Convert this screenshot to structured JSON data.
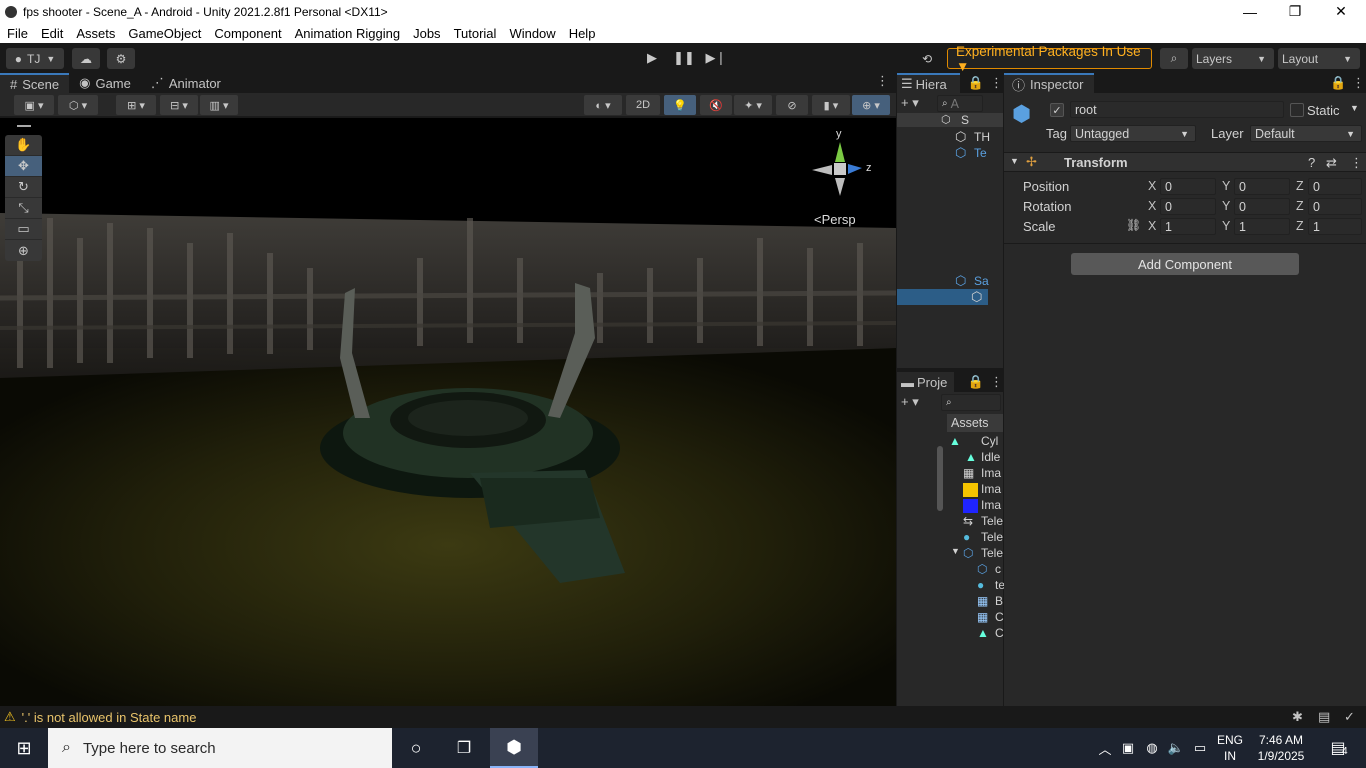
{
  "window": {
    "title": "fps shooter - Scene_A - Android - Unity 2021.2.8f1 Personal <DX11>",
    "minimize": "—",
    "maximize": "❐",
    "close": "✕"
  },
  "menu": [
    "File",
    "Edit",
    "Assets",
    "GameObject",
    "Component",
    "Animation Rigging",
    "Jobs",
    "Tutorial",
    "Window",
    "Help"
  ],
  "toolbar": {
    "account": "TJ",
    "experimental": "Experimental Packages In Use ▼",
    "layers": "Layers",
    "layout": "Layout"
  },
  "scene_tabs": [
    {
      "label": "Scene",
      "icon": "hash-icon"
    },
    {
      "label": "Game",
      "icon": "gamepad-icon"
    },
    {
      "label": "Animator",
      "icon": "animator-icon"
    }
  ],
  "scene_toolbar": {
    "mode_2d": "2D"
  },
  "gizmo": {
    "y": "y",
    "z": "z",
    "persp": "Persp"
  },
  "hierarchy": {
    "title": "Hiera",
    "search_placeholder": "A",
    "items": [
      "S",
      "TH",
      "Te",
      "",
      "",
      "Sa",
      "",
      "",
      "",
      ""
    ]
  },
  "project": {
    "title": "Proje",
    "breadcrumb": "Assets",
    "items": [
      "Cyl",
      "Idle",
      "Ima",
      "Ima",
      "Ima",
      "Tele",
      "Tele",
      "Tele",
      "c",
      "te",
      "B",
      "C",
      "C"
    ]
  },
  "inspector": {
    "title": "Inspector",
    "object_name": "root",
    "static_label": "Static",
    "tag_label": "Tag",
    "tag_value": "Untagged",
    "layer_label": "Layer",
    "layer_value": "Default",
    "component_title": "Transform",
    "rows": [
      {
        "label": "Position",
        "x": "0",
        "y": "0",
        "z": "0"
      },
      {
        "label": "Rotation",
        "x": "0",
        "y": "0",
        "z": "0"
      },
      {
        "label": "Scale",
        "x": "1",
        "y": "1",
        "z": "1"
      }
    ],
    "axis_x": "X",
    "axis_y": "Y",
    "axis_z": "Z",
    "add_component": "Add Component"
  },
  "status": {
    "message": "'.' is not allowed in State name"
  },
  "taskbar": {
    "search_placeholder": "Type here to search",
    "lang_top": "ENG",
    "lang_bottom": "IN",
    "time": "7:46 AM",
    "date": "1/9/2025",
    "notif_count": "4"
  }
}
